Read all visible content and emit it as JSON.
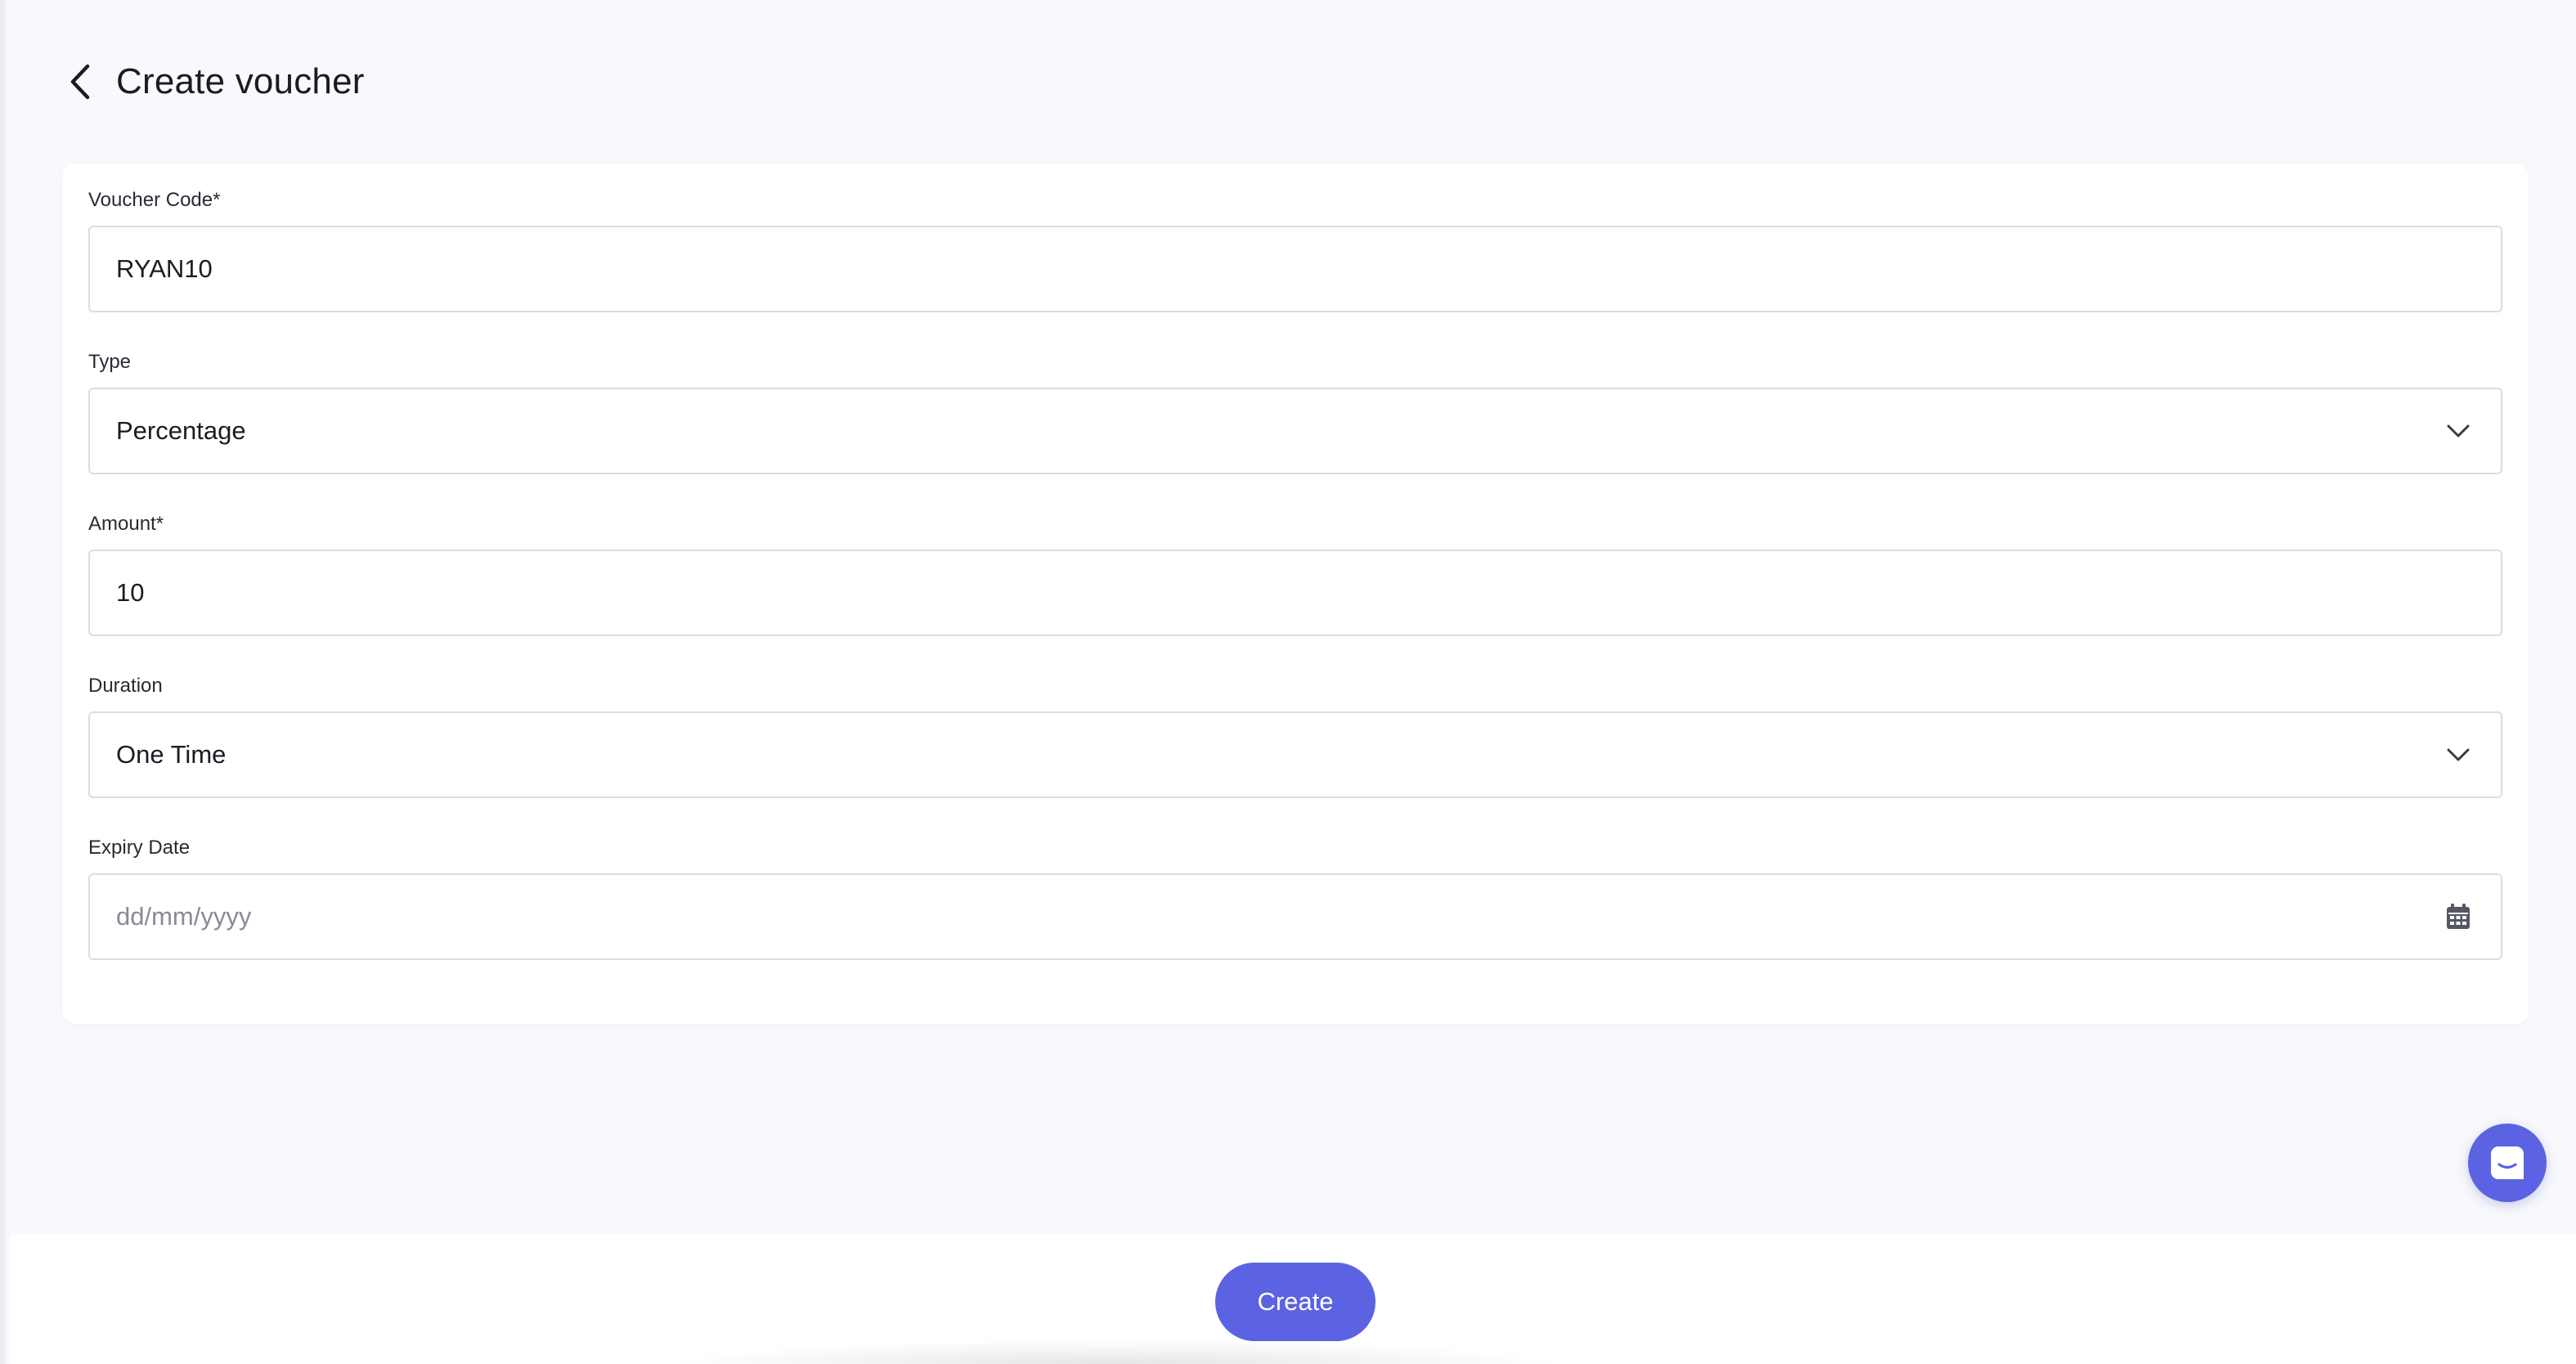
{
  "header": {
    "title": "Create voucher",
    "back_icon": "chevron-left-icon"
  },
  "form": {
    "voucher_code": {
      "label": "Voucher Code*",
      "value": "RYAN10"
    },
    "type": {
      "label": "Type",
      "value": "Percentage",
      "icon": "chevron-down-icon"
    },
    "amount": {
      "label": "Amount*",
      "value": "10"
    },
    "duration": {
      "label": "Duration",
      "value": "One Time",
      "icon": "chevron-down-icon"
    },
    "expiry_date": {
      "label": "Expiry Date",
      "placeholder": "dd/mm/yyyy",
      "icon": "calendar-icon"
    }
  },
  "footer": {
    "create_label": "Create"
  },
  "chat": {
    "icon": "chat-icon"
  },
  "colors": {
    "accent": "#5b63e3",
    "background": "#f8f9fd",
    "border": "#dcdde5"
  }
}
